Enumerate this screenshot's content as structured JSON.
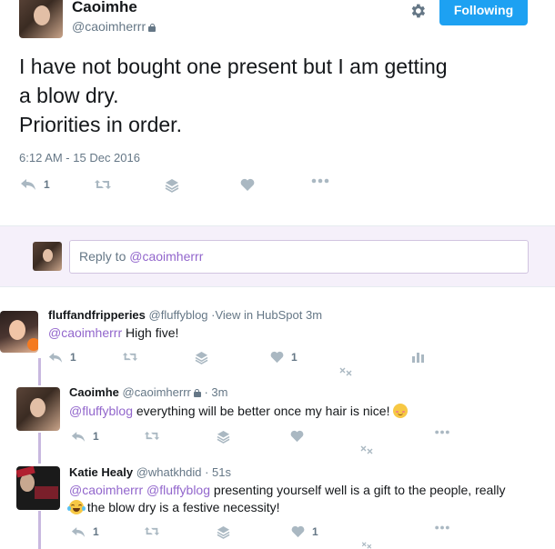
{
  "main_tweet": {
    "name": "Caoimhe",
    "handle": "@caoimherrr",
    "follow_label": "Following",
    "text": "I have not bought one present but I am getting\na blow dry.\nPriorities in order.",
    "timestamp": "6:12 AM - 15 Dec 2016",
    "reply_count": "1",
    "accent_color": "#1da1f2"
  },
  "reply_box": {
    "prefix": "Reply to ",
    "mention": "@caoimherrr"
  },
  "replies": [
    {
      "name": "fluffandfripperies",
      "handle": "@fluffyblog",
      "source": "·View in HubSpot",
      "time": "3m",
      "mention": "@caoimherrr",
      "text": " High five!",
      "reply_count": "1",
      "like_count": "1"
    },
    {
      "name": "Caoimhe",
      "handle": "@caoimherrr",
      "time": "· 3m",
      "mention": "@fluffyblog",
      "text": " everything will be better once my hair is nice!",
      "reply_count": "1"
    },
    {
      "name": "Katie Healy",
      "handle": "@whatkhdid",
      "time": "· 51s",
      "mention1": "@caoimherrr",
      "mention2": "@fluffyblog",
      "text_line1": " presenting yourself well is a gift to the people, really",
      "text_line2": " the blow dry is a festive necessity!",
      "reply_count": "1",
      "like_count": "1"
    }
  ]
}
